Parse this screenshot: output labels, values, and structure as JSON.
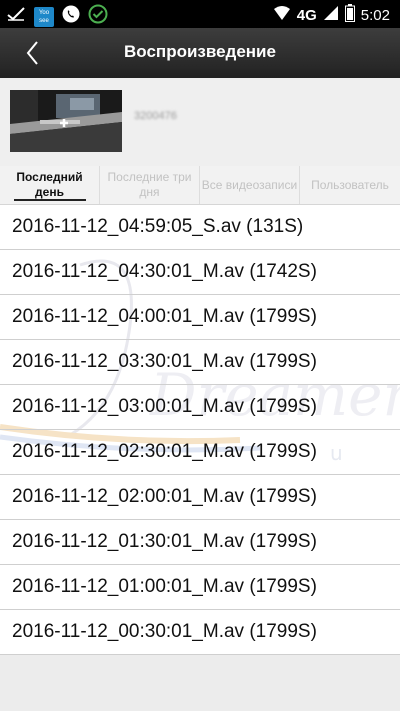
{
  "status_bar": {
    "network": "4G",
    "time": "5:02",
    "badge": "Yoo see",
    "icons": [
      "check-icon",
      "yoosee-icon",
      "phone-icon",
      "check-circle-icon",
      "wifi-icon",
      "signal-icon",
      "battery-icon"
    ]
  },
  "header": {
    "title": "Воспроизведение",
    "back_icon": "chevron-left-icon"
  },
  "device": {
    "name": "3200476"
  },
  "tabs": [
    {
      "label": "Последний день",
      "active": true
    },
    {
      "label": "Последние три дня",
      "active": false
    },
    {
      "label": "Все видеозаписи",
      "active": false
    },
    {
      "label": "Пользователь",
      "active": false
    }
  ],
  "recordings": [
    "2016-11-12_04:59:05_S.av (131S)",
    "2016-11-12_04:30:01_M.av (1742S)",
    "2016-11-12_04:00:01_M.av (1799S)",
    "2016-11-12_03:30:01_M.av (1799S)",
    "2016-11-12_03:00:01_M.av (1799S)",
    "2016-11-12_02:30:01_M.av (1799S)",
    "2016-11-12_02:00:01_M.av (1799S)",
    "2016-11-12_01:30:01_M.av (1799S)",
    "2016-11-12_01:00:01_M.av (1799S)",
    "2016-11-12_00:30:01_M.av (1799S)"
  ],
  "colors": {
    "header_bg": "#2b2b2b",
    "list_bg": "#ffffff",
    "accent": "#4caf50"
  }
}
